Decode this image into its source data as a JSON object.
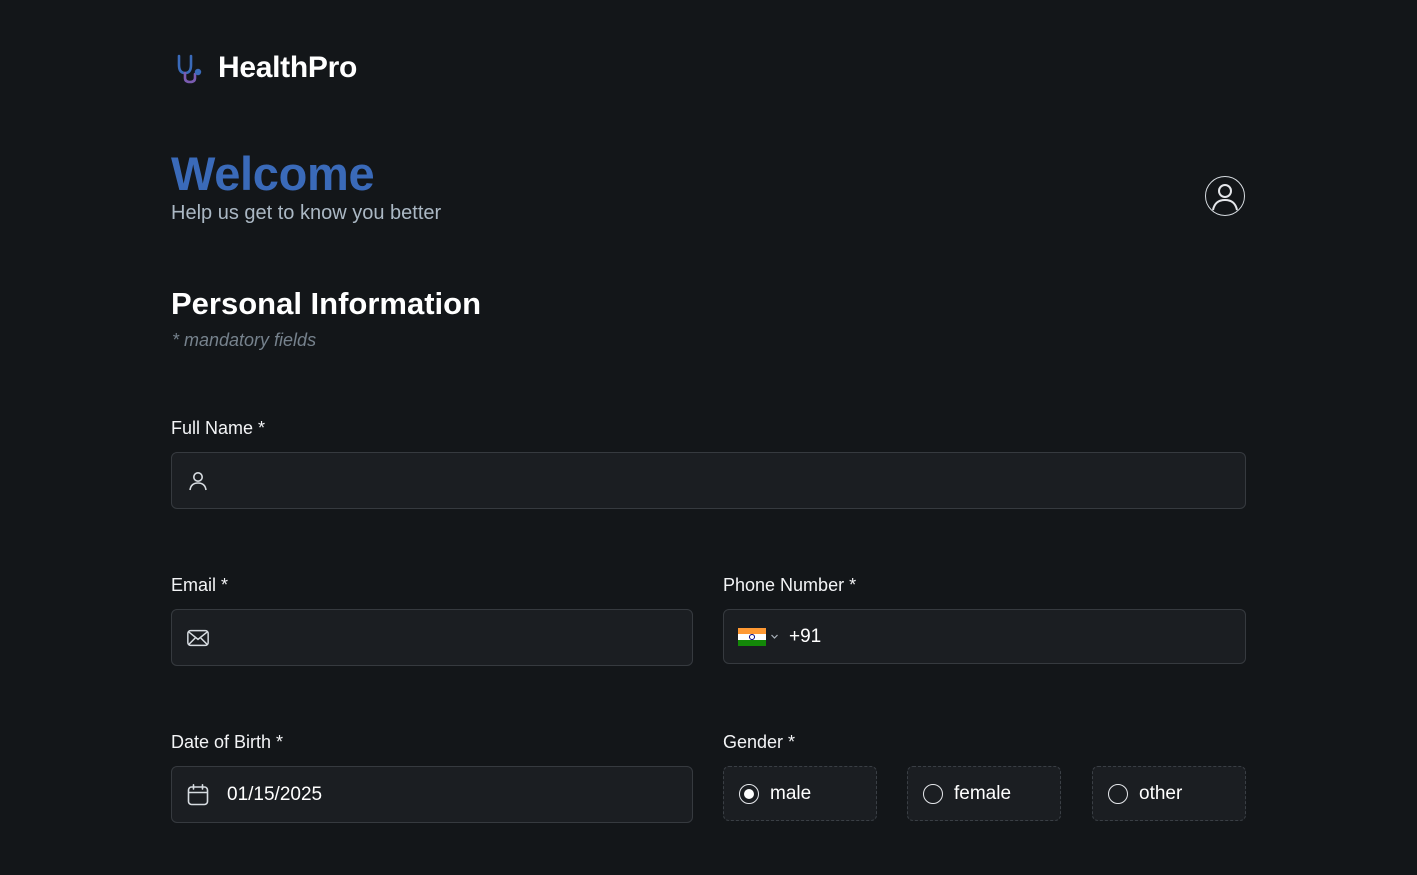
{
  "brand": {
    "name": "HealthPro",
    "accent": "#3a6ab9"
  },
  "welcome": {
    "title": "Welcome",
    "subtitle": "Help us get to know you better"
  },
  "section": {
    "title": "Personal Information",
    "note": "* mandatory fields"
  },
  "form": {
    "full_name": {
      "label": "Full Name *",
      "value": "",
      "icon": "user-icon"
    },
    "email": {
      "label": "Email *",
      "value": "",
      "icon": "mail-icon"
    },
    "phone": {
      "label": "Phone Number *",
      "country": "India",
      "code": "+91",
      "value": ""
    },
    "dob": {
      "label": "Date of Birth *",
      "value": "01/15/2025",
      "icon": "calendar-icon"
    },
    "gender": {
      "label": "Gender *",
      "options": [
        "male",
        "female",
        "other"
      ],
      "selected": "male"
    }
  }
}
